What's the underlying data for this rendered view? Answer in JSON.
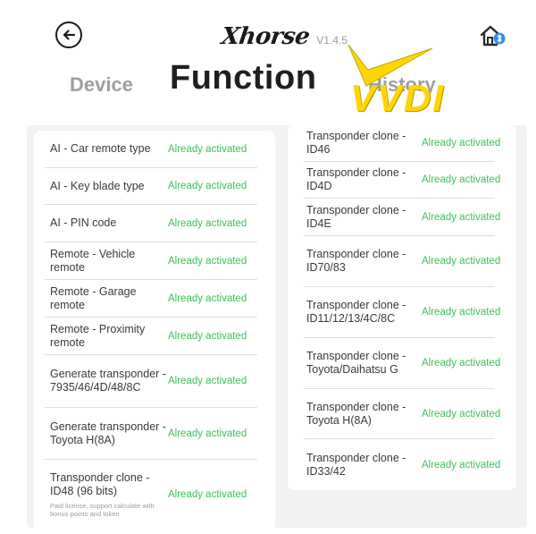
{
  "header": {
    "brand": "Xhorse",
    "version": "V1.4.5",
    "watermark": "VVDI",
    "colors": {
      "active_tab": "#1f1f1f",
      "inactive_tab": "#9e9e9e",
      "status": "#3dbf5a",
      "watermark": "#ffd700"
    }
  },
  "tabs": {
    "device": "Device",
    "function": "Function",
    "history": "History"
  },
  "left_list": [
    {
      "label": "AI - Car remote type",
      "status": "Already activated"
    },
    {
      "label": "AI - Key blade type",
      "status": "Already activated"
    },
    {
      "label": "AI - PIN code",
      "status": "Already activated"
    },
    {
      "label": "Remote - Vehicle remote",
      "status": "Already activated"
    },
    {
      "label": "Remote - Garage remote",
      "status": "Already activated"
    },
    {
      "label": "Remote - Proximity remote",
      "status": "Already activated"
    },
    {
      "label": "Generate transponder - 7935/46/4D/48/8C",
      "status": "Already activated"
    },
    {
      "label": "Generate transponder - Toyota H(8A)",
      "status": "Already activated"
    },
    {
      "label": "Transponder clone - ID48 (96 bits)",
      "status": "Already activated",
      "note": "Paid license, support calculate with bonus points and token"
    }
  ],
  "right_list": [
    {
      "label": "Transponder clone - ID46",
      "status": "Already activated"
    },
    {
      "label": "Transponder clone - ID4D",
      "status": "Already activated"
    },
    {
      "label": "Transponder clone - ID4E",
      "status": "Already activated"
    },
    {
      "label": "Transponder clone - ID70/83",
      "status": "Already activated"
    },
    {
      "label": "Transponder clone - ID11/12/13/4C/8C",
      "status": "Already activated"
    },
    {
      "label": "Transponder clone - Toyota/Daihatsu G",
      "status": "Already activated"
    },
    {
      "label": "Transponder clone - Toyota H(8A)",
      "status": "Already activated"
    },
    {
      "label": "Transponder clone - ID33/42",
      "status": "Already activated"
    }
  ]
}
